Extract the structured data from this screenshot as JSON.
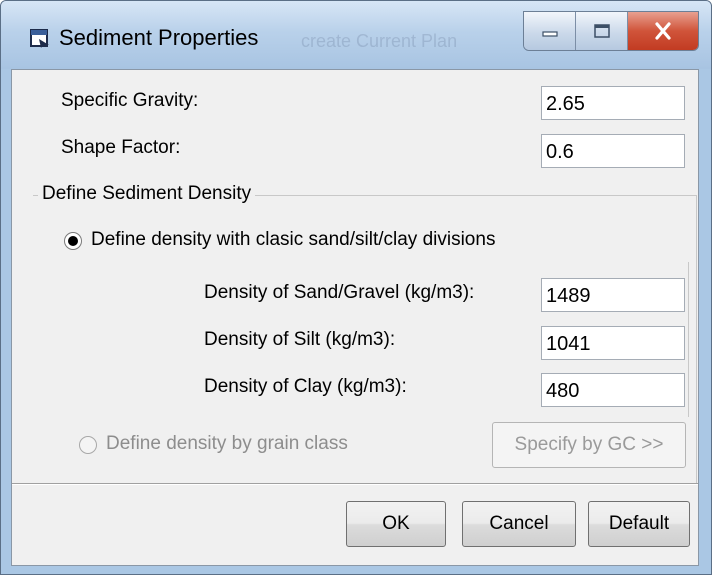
{
  "window": {
    "title": "Sediment Properties",
    "background_text": "create Current Plan",
    "controls": [
      "minimize-icon",
      "maximize-icon",
      "close-icon"
    ],
    "close_color": "#c8452d"
  },
  "fields": {
    "specific_gravity": {
      "label": "Specific Gravity:",
      "value": "2.65"
    },
    "shape_factor": {
      "label": "Shape Factor:",
      "value": "0.6"
    }
  },
  "density_group": {
    "legend": "Define Sediment Density",
    "option_classic": {
      "label": "Define density with clasic sand/silt/clay divisions",
      "selected": true
    },
    "sand": {
      "label": "Density of Sand/Gravel (kg/m3):",
      "value": "1489"
    },
    "silt": {
      "label": "Density of Silt (kg/m3):",
      "value": "1041"
    },
    "clay": {
      "label": "Density of Clay (kg/m3):",
      "value": "480"
    },
    "option_grain": {
      "label": "Define density by grain class",
      "selected": false,
      "enabled": false
    },
    "specify_button": "Specify by GC >>"
  },
  "footer": {
    "ok": "OK",
    "cancel": "Cancel",
    "default": "Default"
  }
}
